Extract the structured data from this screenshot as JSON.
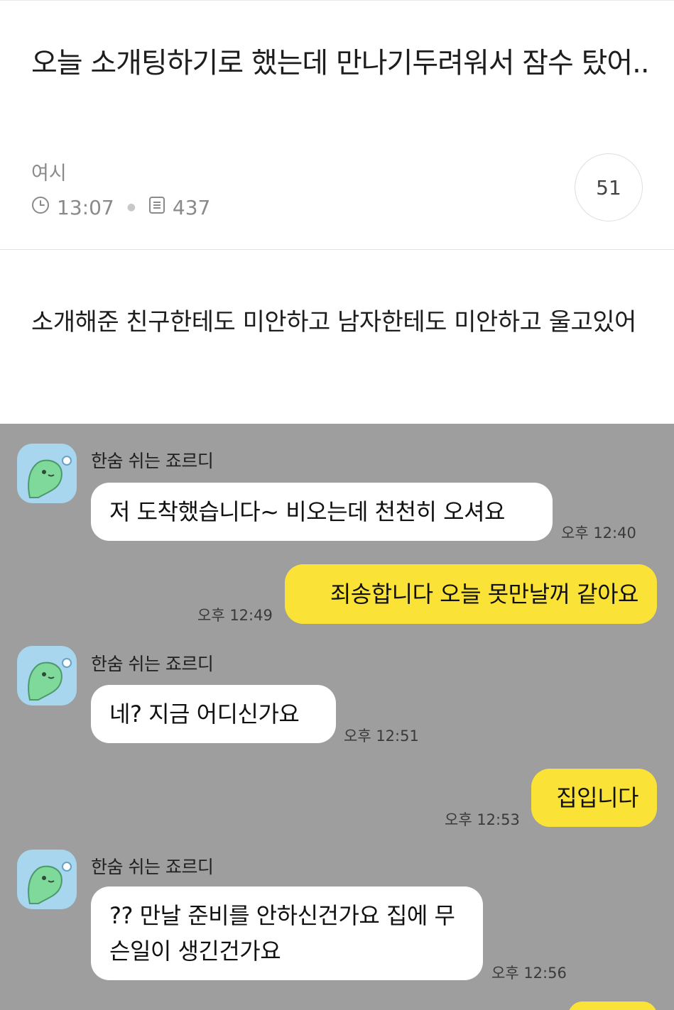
{
  "post": {
    "title": "오늘 소개팅하기로 했는데 만나기두려워서 잠수 탔어..",
    "author": "여시",
    "time": "13:07",
    "views": "437",
    "comment_count": "51",
    "body": "소개해준 친구한테도 미안하고 남자한테도 미안하고 울고있어"
  },
  "chat": {
    "messages": [
      {
        "side": "left",
        "sender": "한숨 쉬는 죠르디",
        "text": "저 도착했습니다~ 비오는데 천천히 오셔요",
        "time": "오후 12:40"
      },
      {
        "side": "right",
        "text": "죄송합니다 오늘 못만날꺼 같아요",
        "time": "오후 12:49"
      },
      {
        "side": "left",
        "sender": "한숨 쉬는 죠르디",
        "text": "네? 지금 어디신가요",
        "time": "오후 12:51"
      },
      {
        "side": "right",
        "text": "집입니다",
        "time": "오후 12:53"
      },
      {
        "side": "left",
        "sender": "한숨 쉬는 죠르디",
        "text": "?? 만날 준비를 안하신건가요 집에 무슨일이 생긴건가요",
        "time": "오후 12:56"
      }
    ]
  },
  "colors": {
    "chat_background": "#9e9e9e",
    "my_bubble": "#fbe237",
    "their_bubble": "#ffffff",
    "avatar_background": "#a9d6ef",
    "avatar_character": "#7fd99a"
  },
  "icons": {
    "time": "clock-icon",
    "views": "document-icon",
    "avatar": "green-dinosaur-avatar"
  }
}
